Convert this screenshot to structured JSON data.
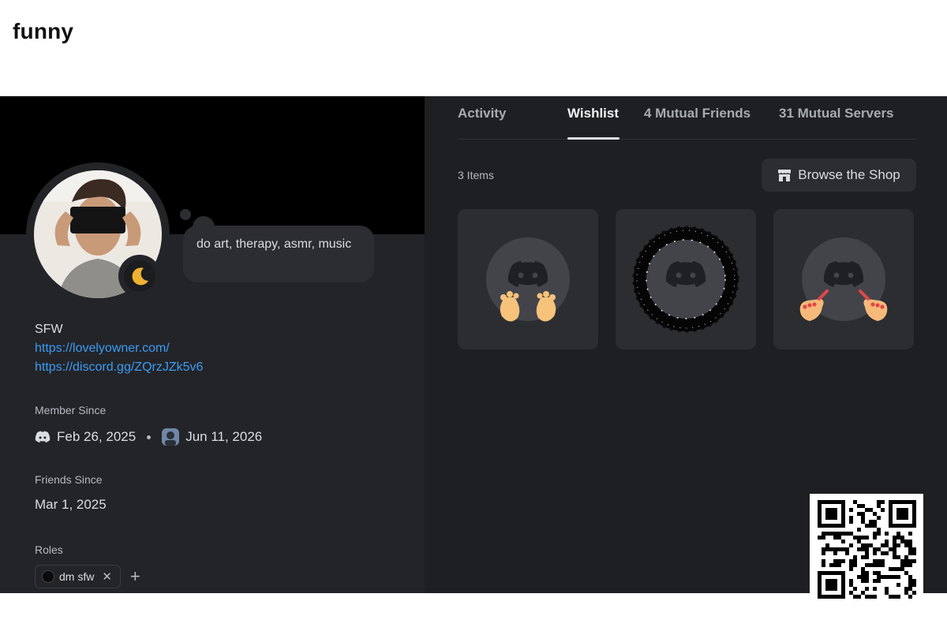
{
  "post": {
    "title": "funny"
  },
  "profile": {
    "bio_bubble": "do art, therapy, asmr, music",
    "bio_lines": {
      "line1": "SFW"
    },
    "links": [
      "https://lovelyowner.com/",
      "https://discord.gg/ZQrzJZk5v6"
    ],
    "member_since": {
      "label": "Member Since",
      "discord_date": "Feb 26, 2025",
      "server_date": "Jun 11, 2026"
    },
    "friends_since": {
      "label": "Friends Since",
      "date": "Mar 1, 2025"
    },
    "roles": {
      "label": "Roles",
      "items": [
        {
          "name": "dm sfw",
          "color": "#0a0a0a"
        }
      ],
      "add_symbol": "+",
      "remove_symbol": "✕"
    },
    "status_icon": "moon-icon"
  },
  "tabs": [
    {
      "label": "Activity",
      "active": false
    },
    {
      "label": "Wishlist",
      "active": true
    },
    {
      "label": "4 Mutual Friends",
      "active": false
    },
    {
      "label": "31 Mutual Servers",
      "active": false
    }
  ],
  "wishlist": {
    "count_label": "3 Items",
    "browse_label": "Browse the Shop",
    "items": [
      {
        "decoration": "feet-decoration"
      },
      {
        "decoration": "black-ink-ring-decoration"
      },
      {
        "decoration": "painted-nails-decoration"
      }
    ]
  },
  "colors": {
    "link": "#3b9cf5",
    "panel": "#232428",
    "background": "#1e1f22",
    "card": "#2b2d31"
  }
}
